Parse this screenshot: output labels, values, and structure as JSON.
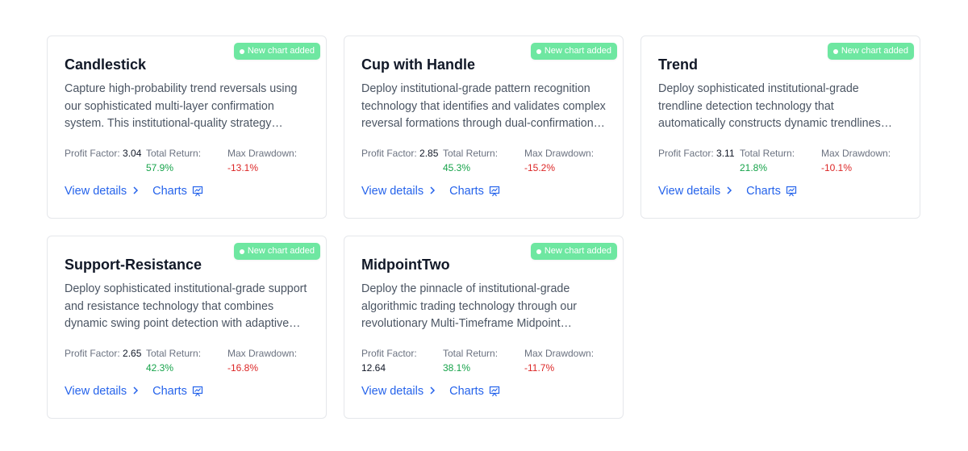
{
  "cards": [
    {
      "badge": "New chart added",
      "title": "Candlestick",
      "description": "Capture high-probability trend reversals using our sophisticated multi-layer confirmation system. This institutional-quality strategy…",
      "profit_factor_label": "Profit Factor:",
      "profit_factor": "3.04",
      "total_return_label": "Total Return:",
      "total_return": "57.9%",
      "max_drawdown_label": "Max Drawdown:",
      "max_drawdown": "-13.1%",
      "view_details": "View details",
      "charts": "Charts"
    },
    {
      "badge": "New chart added",
      "title": "Cup with Handle",
      "description": "Deploy institutional-grade pattern recognition technology that identifies and validates complex reversal formations through dual-confirmation…",
      "profit_factor_label": "Profit Factor:",
      "profit_factor": "2.85",
      "total_return_label": "Total Return:",
      "total_return": "45.3%",
      "max_drawdown_label": "Max Drawdown:",
      "max_drawdown": "-15.2%",
      "view_details": "View details",
      "charts": "Charts"
    },
    {
      "badge": "New chart added",
      "title": "Trend",
      "description": "Deploy sophisticated institutional-grade trendline detection technology that automatically constructs dynamic trendlines…",
      "profit_factor_label": "Profit Factor:",
      "profit_factor": "3.11",
      "total_return_label": "Total Return:",
      "total_return": "21.8%",
      "max_drawdown_label": "Max Drawdown:",
      "max_drawdown": "-10.1%",
      "view_details": "View details",
      "charts": "Charts"
    },
    {
      "badge": "New chart added",
      "title": "Support-Resistance",
      "description": "Deploy sophisticated institutional-grade support and resistance technology that combines dynamic swing point detection with adaptive…",
      "profit_factor_label": "Profit Factor:",
      "profit_factor": "2.65",
      "total_return_label": "Total Return:",
      "total_return": "42.3%",
      "max_drawdown_label": "Max Drawdown:",
      "max_drawdown": "-16.8%",
      "view_details": "View details",
      "charts": "Charts"
    },
    {
      "badge": "New chart added",
      "title": "MidpointTwo",
      "description": "Deploy the pinnacle of institutional-grade algorithmic trading technology through our revolutionary Multi-Timeframe Midpoint…",
      "profit_factor_label": "Profit Factor:",
      "profit_factor": "12.64",
      "total_return_label": "Total Return:",
      "total_return": "38.1%",
      "max_drawdown_label": "Max Drawdown:",
      "max_drawdown": "-11.7%",
      "view_details": "View details",
      "charts": "Charts"
    }
  ],
  "colors": {
    "badge_bg": "#6ee7a1",
    "positive": "#16a34a",
    "negative": "#dc2626",
    "link": "#2563eb"
  },
  "icons": {
    "view_details": "chevron-right-icon",
    "charts": "presentation-chart-icon",
    "badge": "dot-icon"
  }
}
